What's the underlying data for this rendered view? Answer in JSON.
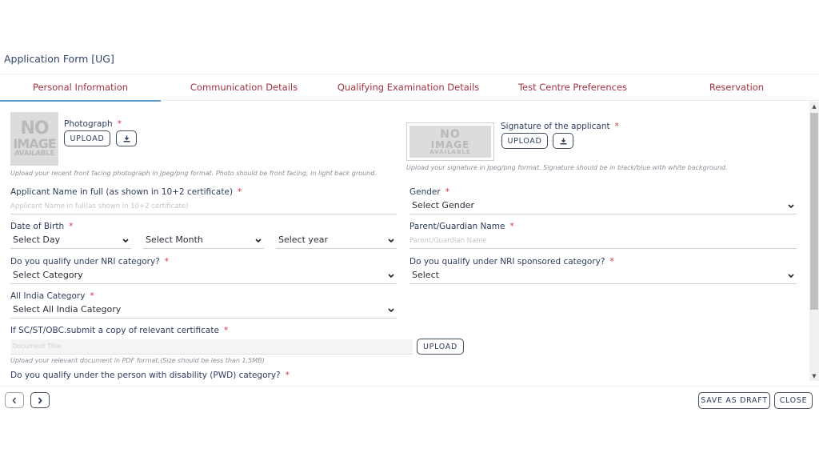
{
  "header": {
    "title": "Application Form [UG]"
  },
  "tabs": [
    {
      "label": "Personal Information",
      "active": true
    },
    {
      "label": "Communication Details",
      "active": false
    },
    {
      "label": "Qualifying Examination Details",
      "active": false
    },
    {
      "label": "Test Centre Preferences",
      "active": false
    },
    {
      "label": "Reservation",
      "active": false
    }
  ],
  "colors": {
    "tab_text": "#a0343f",
    "tab_active_underline": "#5a9fd0",
    "required": "#d9323f",
    "label": "#2f3d5e"
  },
  "placeholder_image": {
    "line1": "NO",
    "line2": "IMAGE",
    "line3": "AVAILABLE"
  },
  "photo": {
    "label": "Photograph",
    "required_mark": "*",
    "upload_label": "UPLOAD",
    "download_icon": "download-icon",
    "hint": "Upload your recent front facing photograph in Jpeg/png format. Photo should be front facing, in light back ground."
  },
  "signature": {
    "label": "Signature of the applicant",
    "required_mark": "*",
    "upload_label": "UPLOAD",
    "download_icon": "download-icon",
    "hint": "Upload your signature in Jpeg/png format. Signature should be in black/blue with white background."
  },
  "fields": {
    "applicant_name": {
      "label": "Applicant Name in full (as shown in 10+2 certificate)",
      "required_mark": "*",
      "placeholder": "Applicant Name in full(as shown in 10+2 certificate)",
      "value": ""
    },
    "gender": {
      "label": "Gender",
      "required_mark": "*",
      "selected": "Select Gender"
    },
    "dob": {
      "label": "Date of Birth",
      "required_mark": "*",
      "day": "Select Day",
      "month": "Select Month",
      "year": "Select year"
    },
    "parent_name": {
      "label": "Parent/Guardian Name",
      "required_mark": "*",
      "placeholder": "Parent/Guardian Name",
      "value": ""
    },
    "nri": {
      "label": "Do you qualify under NRI category?",
      "required_mark": "*",
      "selected": "Select Category"
    },
    "nri_sponsored": {
      "label": "Do you qualify under NRI sponsored category?",
      "required_mark": "*",
      "selected": "Select"
    },
    "all_india_category": {
      "label": "All India Category",
      "required_mark": "*",
      "selected": "Select All India Category"
    },
    "certificate": {
      "label": "If SC/ST/OBC.submit a copy of relevant certificate",
      "required_mark": "*",
      "placeholder": "Document Title",
      "upload_label": "UPLOAD",
      "hint": "Upload your relevant document in PDF format.(Size should be less than 1.5MB)"
    },
    "pwd": {
      "label": "Do you qualify under the person with disability (PWD) category?",
      "required_mark": "*"
    }
  },
  "footer": {
    "prev_icon": "chevron-left-icon",
    "next_icon": "chevron-right-icon",
    "save_draft_label": "SAVE AS DRAFT",
    "close_label": "CLOSE"
  }
}
